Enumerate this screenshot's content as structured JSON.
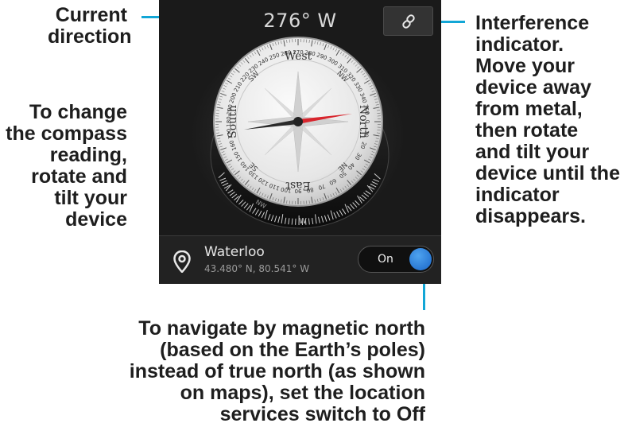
{
  "callouts": {
    "current_direction": [
      "Current",
      "direction"
    ],
    "change_reading": [
      "To change",
      "the compass",
      "reading,",
      "rotate and",
      "tilt your",
      "device"
    ],
    "interference": [
      "Interference",
      "indicator.",
      "Move your",
      "device away",
      "from metal,",
      "then rotate",
      "and tilt your",
      "device until the",
      "indicator",
      "disappears."
    ],
    "magnetic_north": [
      "To navigate by magnetic north",
      "(based on the Earth’s poles)",
      "instead of true north (as shown",
      "on maps), set the location",
      "services switch to Off"
    ]
  },
  "app": {
    "heading": "276° W",
    "interference_icon": "link-icon",
    "location": {
      "icon": "location-pin-icon",
      "name": "Waterloo",
      "coords": "43.480° N, 80.541° W"
    },
    "location_services_toggle": {
      "label": "On",
      "state": "on"
    }
  },
  "compass": {
    "cardinals": {
      "north": "North",
      "south": "South",
      "east": "East",
      "west": "West"
    },
    "intercardinals": {
      "nw": "NW",
      "sw": "SW",
      "ne": "NE",
      "se": "SE"
    },
    "degree_labels": [
      "0",
      "10",
      "20",
      "30",
      "40",
      "50",
      "60",
      "70",
      "80",
      "90",
      "100",
      "110",
      "120",
      "130",
      "140",
      "150",
      "160",
      "170",
      "180",
      "190",
      "200",
      "210",
      "220",
      "230",
      "240",
      "250",
      "260",
      "270",
      "280",
      "290",
      "300",
      "310",
      "320",
      "330",
      "340",
      "350"
    ],
    "bezel_letter": "W",
    "bezel_letter2": "NW"
  },
  "colors": {
    "accent": "#12a6d6",
    "needle_north": "#d8262e",
    "needle_south": "#2a2a2a",
    "toggle_on": "#2a7fe0"
  }
}
